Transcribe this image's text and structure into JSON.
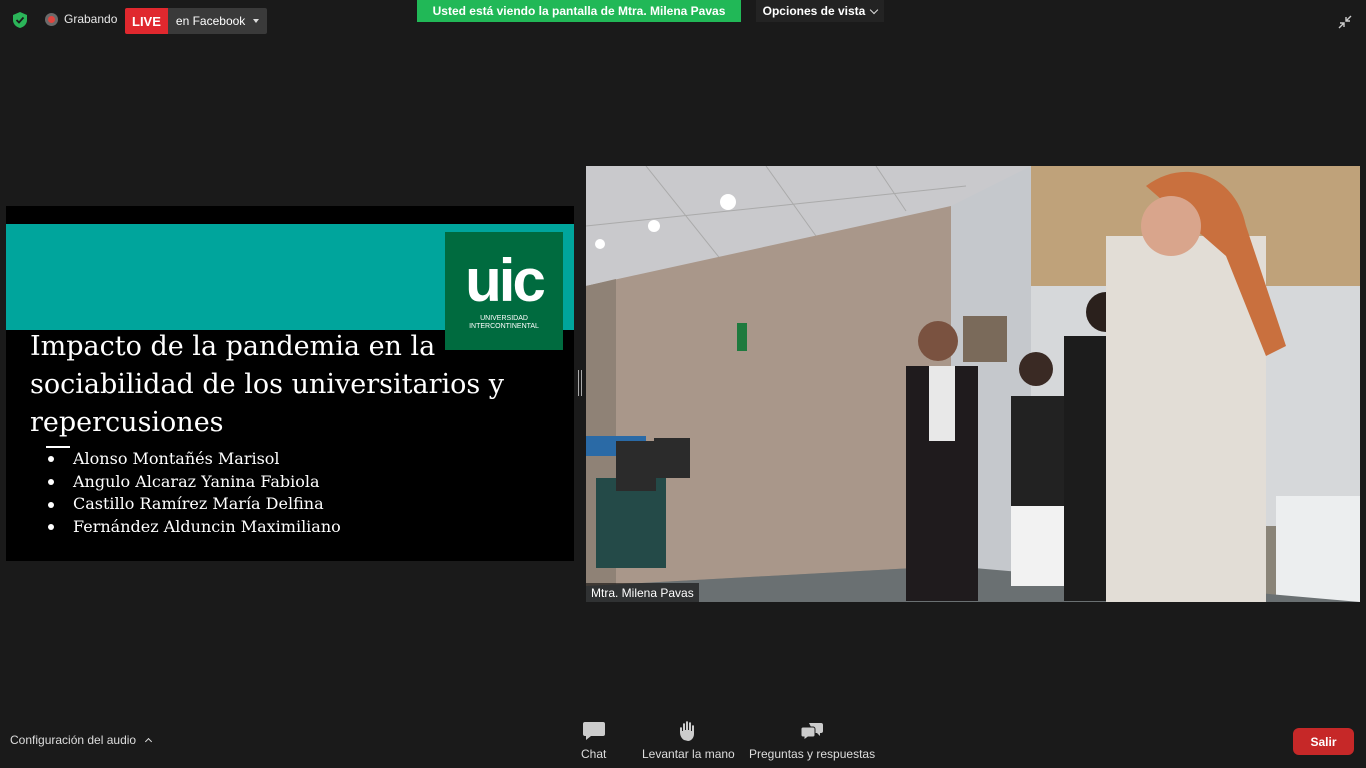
{
  "status": {
    "recording_label": "Grabando",
    "live_badge": "LIVE",
    "live_destination": "en Facebook"
  },
  "banner": {
    "viewing_text": "Usted está viendo la pantalla de Mtra. Milena Pavas",
    "view_options_label": "Opciones de vista"
  },
  "slide": {
    "logo_text": "uic",
    "logo_subtitle_line1": "UNIVERSIDAD",
    "logo_subtitle_line2": "INTERCONTINENTAL",
    "title_line1": "Impacto de la pandemia en la",
    "title_line2": "sociabilidad de los universitarios y",
    "title_line3": "repercusiones",
    "authors": [
      "Alonso Montañés Marisol",
      "Angulo Alcaraz Yanina Fabiola",
      "Castillo Ramírez María Delfina",
      "Fernández Alduncin Maximiliano"
    ]
  },
  "video": {
    "participant_name": "Mtra. Milena Pavas"
  },
  "toolbar": {
    "audio_config_label": "Configuración del audio",
    "chat_label": "Chat",
    "raise_hand_label": "Levantar la mano",
    "qa_label": "Preguntas y respuestas",
    "exit_label": "Salir"
  },
  "colors": {
    "live_red": "#e0282e",
    "banner_green": "#21b857",
    "slide_teal": "#00a59c",
    "logo_green": "#006b3f",
    "exit_red": "#c62828"
  }
}
